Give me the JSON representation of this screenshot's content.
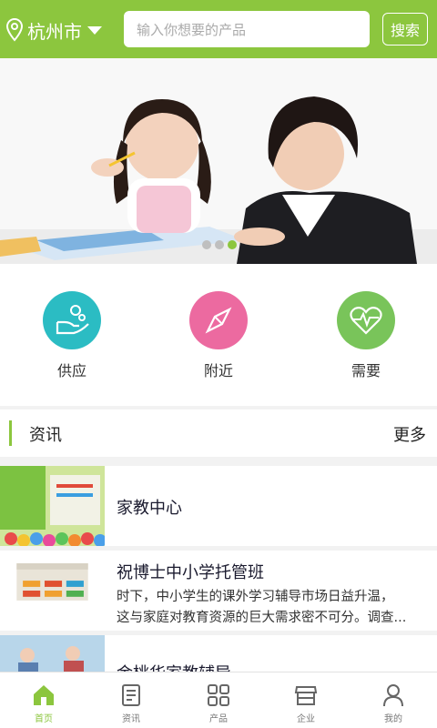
{
  "header": {
    "city": "杭州市",
    "search_placeholder": "输入你想要的产品",
    "search_button": "搜索"
  },
  "banner": {
    "slides": 3,
    "active": 3
  },
  "quick_actions": [
    {
      "label": "供应",
      "icon": "supply-hand-icon",
      "color": "#2bbcc3"
    },
    {
      "label": "附近",
      "icon": "compass-icon",
      "color": "#ec6aa0"
    },
    {
      "label": "需要",
      "icon": "heart-pulse-icon",
      "color": "#79c45a"
    }
  ],
  "news": {
    "title": "资讯",
    "more": "更多",
    "items": [
      {
        "title": "家教中心",
        "desc1": "",
        "desc2": ""
      },
      {
        "title": "祝博士中小学托管班",
        "desc1": "时下，中小学生的课外学习辅导市场日益升温，",
        "desc2": "这与家庭对教育资源的巨大需求密不可分。调查..."
      },
      {
        "title": "金桃华家教辅导",
        "desc1": "",
        "desc2": ""
      }
    ]
  },
  "tabbar": [
    {
      "label": "首页",
      "icon": "home-icon",
      "active": true
    },
    {
      "label": "资讯",
      "icon": "news-icon",
      "active": false
    },
    {
      "label": "产品",
      "icon": "grid-icon",
      "active": false
    },
    {
      "label": "企业",
      "icon": "company-icon",
      "active": false
    },
    {
      "label": "我的",
      "icon": "user-icon",
      "active": false
    }
  ],
  "colors": {
    "accent": "#8cc63e"
  }
}
